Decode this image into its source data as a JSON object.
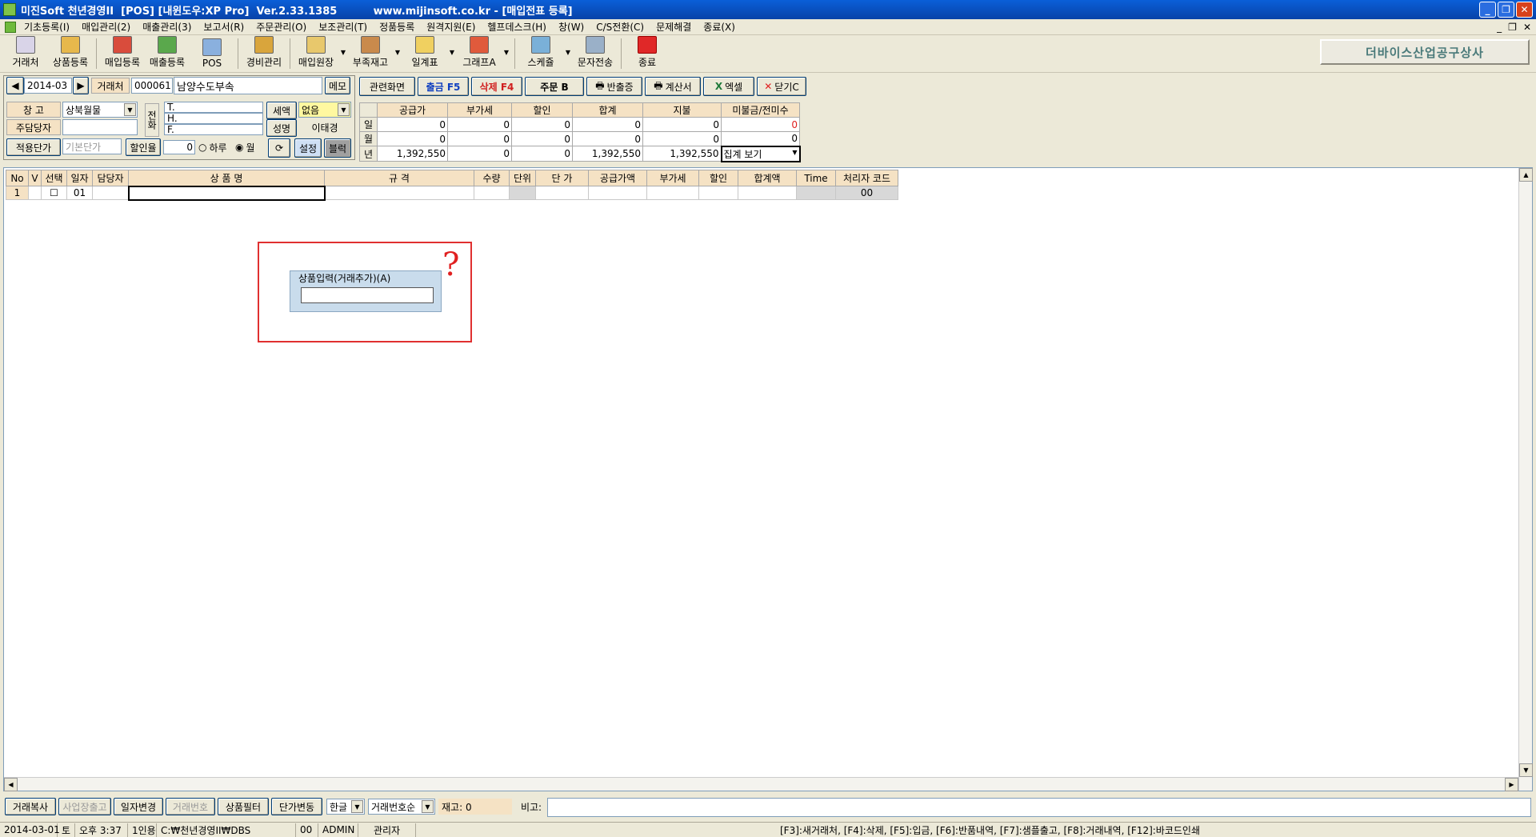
{
  "window": {
    "title": "미진Soft 천년경영II  [POS] [내윈도우:XP Pro]  Ver.2.33.1385          www.mijinsoft.co.kr - [매입전표 등록]"
  },
  "menu": [
    "기초등록(I)",
    "매입관리(2)",
    "매출관리(3)",
    "보고서(R)",
    "주문관리(O)",
    "보조관리(T)",
    "정품등록",
    "원격지원(E)",
    "헬프데스크(H)",
    "창(W)",
    "C/S전환(C)",
    "문제해결",
    "종료(X)"
  ],
  "toolbar": {
    "buttons": [
      {
        "label": "거래처",
        "icon": "client-icon",
        "color": "#d9d4e8"
      },
      {
        "label": "상품등록",
        "icon": "product-icon",
        "color": "#e7b84c"
      },
      {
        "label": "매입등록",
        "icon": "purchase-icon",
        "color": "#d94c3c"
      },
      {
        "label": "매출등록",
        "icon": "sales-icon",
        "color": "#5aa84c"
      },
      {
        "label": "POS",
        "icon": "pos-icon",
        "color": "#8ab0de"
      },
      {
        "label": "경비관리",
        "icon": "expense-icon",
        "color": "#d9a53c"
      },
      {
        "label": "매입원장",
        "icon": "ledger-icon",
        "color": "#e8c86c"
      },
      {
        "label": "부족재고",
        "icon": "stock-icon",
        "color": "#c98a4c"
      },
      {
        "label": "일계표",
        "icon": "daily-icon",
        "color": "#f0d060"
      },
      {
        "label": "그래프A",
        "icon": "graph-icon",
        "color": "#e05a3c"
      },
      {
        "label": "스케쥴",
        "icon": "schedule-icon",
        "color": "#7ab0d8"
      },
      {
        "label": "문자전송",
        "icon": "sms-icon",
        "color": "#9ab0c8"
      },
      {
        "label": "종료",
        "icon": "exit-icon",
        "color": "#e02828"
      }
    ],
    "company": "더바이스산업공구상사"
  },
  "header": {
    "date": "2014-03",
    "client_label": "거래처",
    "client_code": "000061",
    "client_name": "남양수도부속",
    "memo": "메모",
    "warehouse_label": "창      고",
    "warehouse_value": "상북월물",
    "manager_label": "주담당자",
    "manager_value": "",
    "price_label": "적용단가",
    "price_value": "기본단가",
    "discount_label": "할인율",
    "discount_value": "0",
    "radio_day": "하루",
    "radio_month": "월",
    "phone_label": "전화",
    "phone_t": "T.",
    "phone_h": "H.",
    "phone_f": "F.",
    "tax_label": "세액",
    "tax_value": "없음",
    "name_label": "성명",
    "name_value": "이태경",
    "setting": "설정",
    "block": "블럭"
  },
  "actions": {
    "related": "관련화면",
    "out": "출금 F5",
    "delete": "삭제 F4",
    "order": "주문 B",
    "return_cert": "반출증",
    "invoice": "계산서",
    "excel": "엑셀",
    "close": "닫기C"
  },
  "summary": {
    "headers": [
      "공급가",
      "부가세",
      "할인",
      "합계",
      "지불",
      "미불금/전미수"
    ],
    "rows": [
      {
        "label": "일",
        "values": [
          "0",
          "0",
          "0",
          "0",
          "0",
          "0"
        ]
      },
      {
        "label": "월",
        "values": [
          "0",
          "0",
          "0",
          "0",
          "0",
          "0"
        ]
      },
      {
        "label": "년",
        "values": [
          "1,392,550",
          "0",
          "0",
          "1,392,550",
          "1,392,550",
          "집계 보기"
        ]
      }
    ]
  },
  "grid": {
    "headers": [
      "No",
      "V",
      "선택",
      "일자",
      "담당자",
      "상 품 명",
      "규 격",
      "수량",
      "단위",
      "단 가",
      "공급가액",
      "부가세",
      "할인",
      "합계액",
      "Time",
      "처리자 코드"
    ],
    "row": [
      "1",
      "",
      "☐",
      "01",
      "",
      "",
      "",
      "",
      "",
      "",
      "",
      "",
      "",
      "",
      "",
      "00"
    ]
  },
  "popup": {
    "label": "상품입력(거래추가)(A)",
    "mark": "?"
  },
  "bottom": {
    "copy": "거래복사",
    "site_out": "사업장출고",
    "date_change": "일자변경",
    "trade_no": "거래번호",
    "product_filter": "상품필터",
    "price_change": "단가변동",
    "lang": "한글",
    "sort": "거래번호순",
    "stock": "재고: 0",
    "note_label": "비고:",
    "note_value": ""
  },
  "status": {
    "date": "2014-03-01",
    "weekday": "토",
    "time": "오후 3:37",
    "mode": "1인용",
    "path": "C:₩천년경영II₩DBS",
    "code": "00",
    "user": "ADMIN",
    "role": "관리자",
    "shortcuts": "[F3]:새거래처, [F4]:삭제, [F5]:입금, [F6]:반품내역, [F7]:샘플출고, [F8]:거래내역, [F12]:바코드인쇄"
  }
}
